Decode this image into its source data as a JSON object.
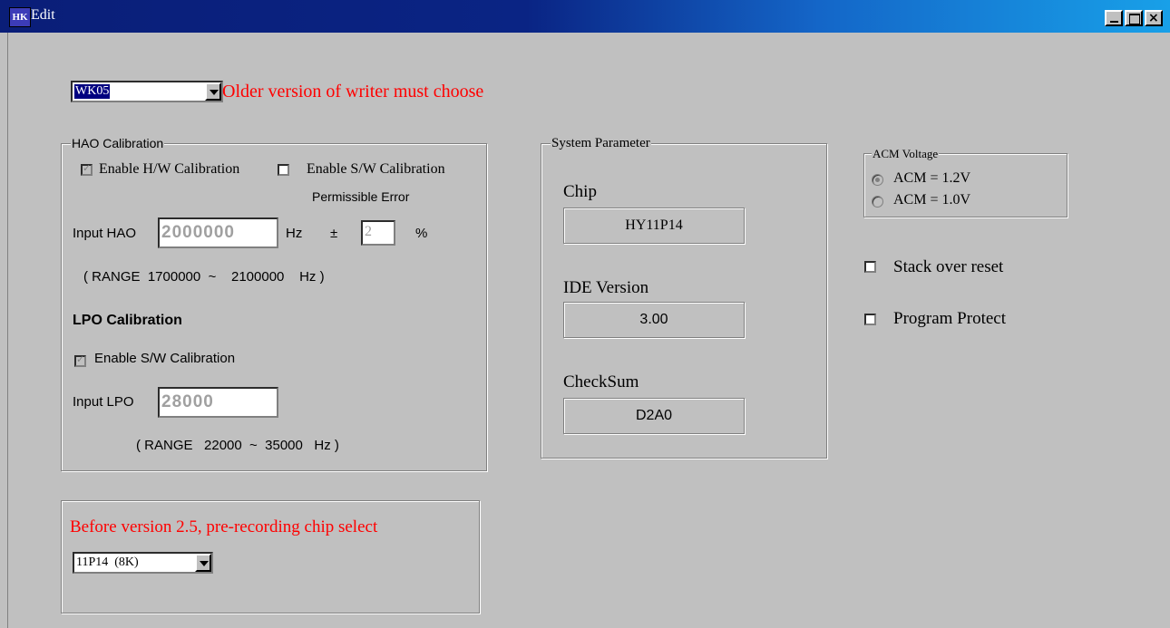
{
  "window": {
    "title": "Edit",
    "app_icon_text": "HK"
  },
  "writer_select": {
    "value": "WK05",
    "note": "Older version of writer must choose"
  },
  "hao_group": {
    "legend": "HAO Calibration",
    "hw_label": "Enable H/W Calibration",
    "sw_label": "Enable S/W Calibration",
    "permissible_error_label": "Permissible Error",
    "input_label": "Input HAO",
    "input_value": "2000000",
    "unit_hz": "Hz",
    "plusminus": "±",
    "error_value": "2",
    "percent": "%",
    "range": "( RANGE  1700000  ~    2100000    Hz )"
  },
  "lpo_group": {
    "title": "LPO Calibration",
    "sw_label": "Enable S/W Calibration",
    "input_label": "Input LPO",
    "input_value": "28000",
    "range": "( RANGE   22000  ~  35000   Hz )"
  },
  "chip_group": {
    "title": "Before version 2.5, pre-recording chip select",
    "select_value": "11P14  (8K)"
  },
  "system_group": {
    "legend": "System Parameter",
    "chip_label": "Chip",
    "chip_value": "HY11P14",
    "ide_label": "IDE Version",
    "ide_value": "3.00",
    "checksum_label": "CheckSum",
    "checksum_value": "D2A0"
  },
  "acm_group": {
    "legend": "ACM Voltage",
    "option1": "ACM = 1.2V",
    "option2": "ACM = 1.0V"
  },
  "options": {
    "stack_over_reset": "Stack over reset",
    "program_protect": "Program Protect"
  }
}
